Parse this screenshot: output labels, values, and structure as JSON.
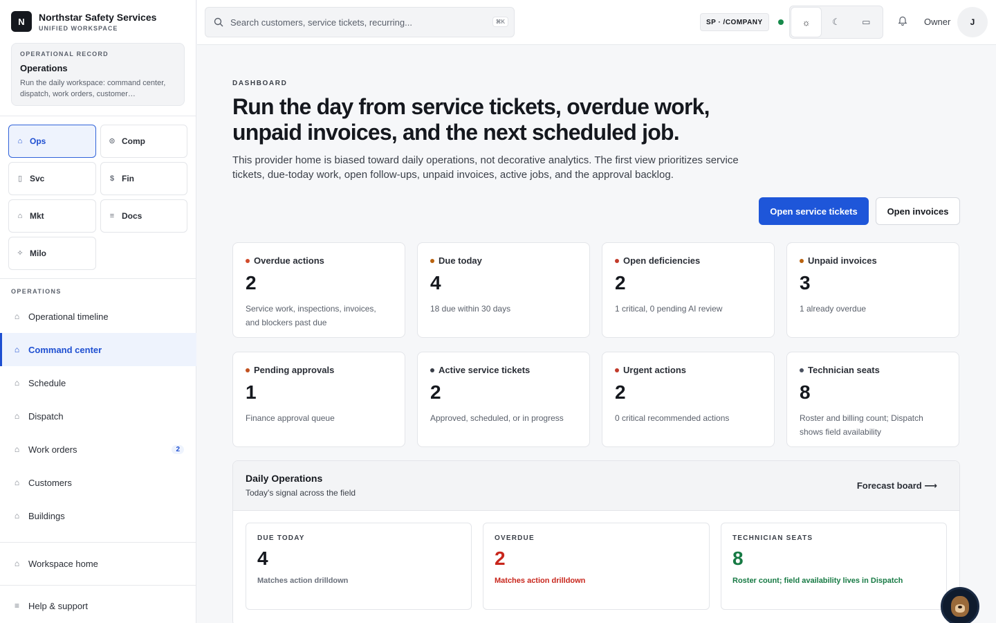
{
  "brand": {
    "logo": "N",
    "name": "Northstar Safety Services",
    "subtitle": "UNIFIED WORKSPACE"
  },
  "record": {
    "label": "OPERATIONAL RECORD",
    "title": "Operations",
    "description": "Run the daily workspace: command center, dispatch, work orders, customer…"
  },
  "modules": [
    {
      "label": "Ops",
      "icon": "home-icon",
      "active": true
    },
    {
      "label": "Comp",
      "icon": "check-circle-icon"
    },
    {
      "label": "Svc",
      "icon": "clipboard-icon"
    },
    {
      "label": "Fin",
      "icon": "dollar-icon"
    },
    {
      "label": "Mkt",
      "icon": "building-icon"
    },
    {
      "label": "Docs",
      "icon": "document-icon"
    },
    {
      "label": "Milo",
      "icon": "sparkle-icon"
    }
  ],
  "nav_section": "OPERATIONS",
  "nav": [
    {
      "label": "Operational timeline"
    },
    {
      "label": "Command center",
      "active": true
    },
    {
      "label": "Schedule"
    },
    {
      "label": "Dispatch"
    },
    {
      "label": "Work orders",
      "badge": "2"
    },
    {
      "label": "Customers"
    },
    {
      "label": "Buildings"
    }
  ],
  "footer_nav": [
    {
      "label": "Workspace home"
    },
    {
      "label": "Help & support"
    }
  ],
  "header": {
    "search_placeholder": "Search customers, service tickets, recurring...",
    "search_shortcut": "⌘K",
    "tenant": "SP · /COMPANY",
    "owner": "Owner",
    "avatar": "J"
  },
  "hero": {
    "eyebrow": "DASHBOARD",
    "title": "Run the day from service tickets, overdue work, unpaid invoices, and the next scheduled job.",
    "lede": "This provider home is biased toward daily operations, not decorative analytics. The first view prioritizes service tickets, due-today work, open follow-ups, unpaid invoices, active jobs, and the approval backlog.",
    "primary": "Open service tickets",
    "secondary": "Open invoices"
  },
  "kpis": [
    {
      "label": "Overdue actions",
      "value": "2",
      "sub": "Service work, inspections, invoices, and blockers past due",
      "dot": "#d14b2b"
    },
    {
      "label": "Due today",
      "value": "4",
      "sub": "18 due within 30 days",
      "dot": "#b9620f"
    },
    {
      "label": "Open deficiencies",
      "value": "2",
      "sub": "1 critical, 0 pending AI review",
      "dot": "#c23a2a"
    },
    {
      "label": "Unpaid invoices",
      "value": "3",
      "sub": "1 already overdue",
      "dot": "#b9620f"
    },
    {
      "label": "Pending approvals",
      "value": "1",
      "sub": "Finance approval queue",
      "dot": "#c2511f"
    },
    {
      "label": "Active service tickets",
      "value": "2",
      "sub": "Approved, scheduled, or in progress",
      "dot": "#3a3f48"
    },
    {
      "label": "Urgent actions",
      "value": "2",
      "sub": "0 critical recommended actions",
      "dot": "#c23a2a"
    },
    {
      "label": "Technician seats",
      "value": "8",
      "sub": "Roster and billing count; Dispatch shows field availability",
      "dot": "#4a5160"
    }
  ],
  "daily": {
    "title": "Daily Operations",
    "subtitle": "Today's signal across the field",
    "link": "Forecast board ⟶",
    "cards": [
      {
        "label": "DUE TODAY",
        "value": "4",
        "sub": "Matches action drilldown",
        "color": "#15181e",
        "subcolor": "#6a707b"
      },
      {
        "label": "OVERDUE",
        "value": "2",
        "sub": "Matches action drilldown",
        "color": "#c8261c",
        "subcolor": "#c8261c"
      },
      {
        "label": "TECHNICIAN SEATS",
        "value": "8",
        "sub": "Roster count; field availability lives in Dispatch",
        "color": "#177a44",
        "subcolor": "#177a44"
      }
    ]
  }
}
